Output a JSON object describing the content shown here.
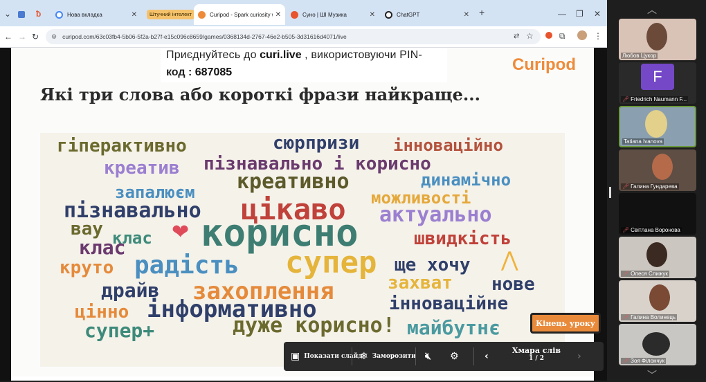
{
  "browser": {
    "tabs": [
      {
        "title": "Нова вкладка",
        "active": false
      },
      {
        "title": "Curipod - Spark curiosity with",
        "active": true
      },
      {
        "title": "Суно | ШІ Музика",
        "active": false
      },
      {
        "title": "ChatGPT",
        "active": false
      }
    ],
    "tab_group_label": "Штучний інтелект",
    "url": "curipod.com/63c03fb4-5b06-5f2a-b27f-e15c096c8659/games/0368134d-2767-46e2-b505-3d31616d4071/live"
  },
  "slide": {
    "join_prefix": "Приєднуйтесь до",
    "join_site": "curi.live",
    "join_middle": ", використовуючи PIN-",
    "join_code_label": "код :",
    "join_pin": "687085",
    "logo": "Curipod",
    "question": "Які три слова або короткі фрази найкраще...",
    "words": [
      {
        "text": "гіперактивно",
        "color": "#6b6a2e"
      },
      {
        "text": "сюрпризи",
        "color": "#2f3f6a"
      },
      {
        "text": "інноваційно",
        "color": "#b4533d"
      },
      {
        "text": "креатив",
        "color": "#9b7fd0"
      },
      {
        "text": "пізнавально і корисно",
        "color": "#6b3a6e"
      },
      {
        "text": "креативно",
        "color": "#5c5a2a"
      },
      {
        "text": "запалюєм",
        "color": "#4a8fc0"
      },
      {
        "text": "динамічно",
        "color": "#4a8fc0"
      },
      {
        "text": "пізнавально",
        "color": "#2f3f6a"
      },
      {
        "text": "цікаво",
        "color": "#c0423a"
      },
      {
        "text": "можливості",
        "color": "#e5a83a"
      },
      {
        "text": "актуально",
        "color": "#9b7fd0"
      },
      {
        "text": "вау",
        "color": "#6b6a2e"
      },
      {
        "text": "клас",
        "color": "#3d8a7a"
      },
      {
        "text": "корисно",
        "color": "#3d7d72"
      },
      {
        "text": "клас",
        "color": "#6b3a6e"
      },
      {
        "text": "швидкість",
        "color": "#c0423a"
      },
      {
        "text": "круто",
        "color": "#e58a3a"
      },
      {
        "text": "радість",
        "color": "#4a8fc0"
      },
      {
        "text": "супер",
        "color": "#e5b43a"
      },
      {
        "text": "ще хочу",
        "color": "#2f3f6a"
      },
      {
        "text": "драйв",
        "color": "#2f3f6a"
      },
      {
        "text": "захоплення",
        "color": "#e58a3a"
      },
      {
        "text": "захват",
        "color": "#e5b43a"
      },
      {
        "text": "нове",
        "color": "#2f3f6a"
      },
      {
        "text": "цінно",
        "color": "#e58a3a"
      },
      {
        "text": "інформативно",
        "color": "#2f3f6a"
      },
      {
        "text": "інноваційне",
        "color": "#2f3f6a"
      },
      {
        "text": "супер+",
        "color": "#3d8a7a"
      },
      {
        "text": "дуже корисно!",
        "color": "#6b6a2e"
      },
      {
        "text": "майбутнє",
        "color": "#4a9aa0"
      }
    ],
    "emoji": {
      "heart": "heart-icon",
      "praying": "praying-hands-icon"
    }
  },
  "toolbar": {
    "show_slide": "Показати слайд",
    "freeze": "Заморозити",
    "slide_title": "Хмара слів",
    "slide_counter": "1 / 2",
    "end_lesson": "Кінець уроку"
  },
  "participants": [
    {
      "name": "Любов Цукор",
      "muted": false
    },
    {
      "name": "Friedrich Naumann F...",
      "muted": true,
      "avatar_letter": "F"
    },
    {
      "name": "Tatiana Ivanova",
      "muted": false
    },
    {
      "name": "Галина Гундарева",
      "muted": true
    },
    {
      "name": "Світлана Воронова",
      "muted": true
    },
    {
      "name": "Олеся Слижук",
      "muted": true
    },
    {
      "name": "Галина Волинець",
      "muted": true
    },
    {
      "name": "Зоя Філончук",
      "muted": true
    }
  ],
  "colors": {
    "accent": "#ee8b3a",
    "tab_strip": "#d4e3f4",
    "active_speaker": "#6b9a3a"
  }
}
